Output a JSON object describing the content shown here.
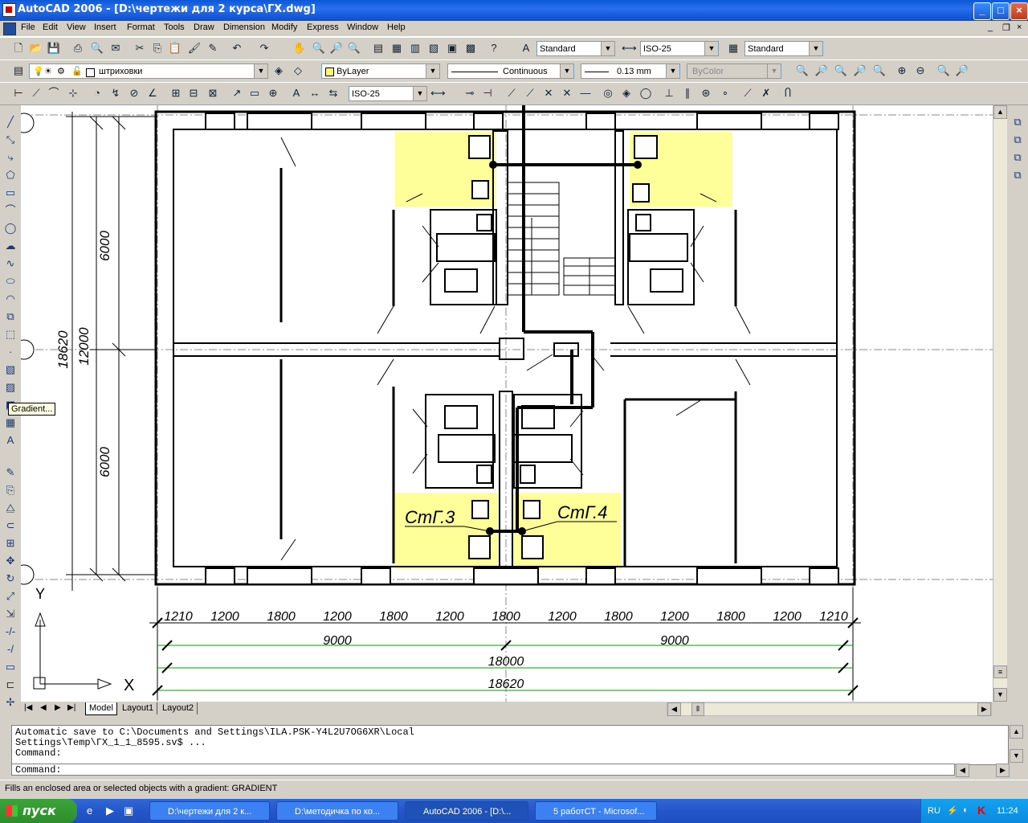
{
  "window": {
    "title": "AutoCAD 2006 - [D:\\чертежи для 2 курса\\ГХ.dwg]"
  },
  "menu": [
    "File",
    "Edit",
    "View",
    "Insert",
    "Format",
    "Tools",
    "Draw",
    "Dimension",
    "Modify",
    "Express",
    "Window",
    "Help"
  ],
  "toolbar_styles": {
    "text_style": "Standard",
    "dim_style": "ISO-25",
    "table_style": "Standard"
  },
  "toolbar_layers": {
    "layer": "штриховки",
    "color": "ByLayer",
    "linetype": "Continuous",
    "lineweight": "0.13 mm",
    "plotstyle": "ByColor"
  },
  "toolbar_dim": {
    "dim_style": "ISO-25"
  },
  "tooltip": "Gradient...",
  "drawing": {
    "dims_left": [
      "6000",
      "12000",
      "6000",
      "18620"
    ],
    "dims_bottom": [
      "1210",
      "1200",
      "1800",
      "1200",
      "1800",
      "1200",
      "1800",
      "1200",
      "1800",
      "1200",
      "1800",
      "1200",
      "1210"
    ],
    "dims_total1": [
      "9000",
      "9000"
    ],
    "dims_total2": "18000",
    "dims_total3": "18620",
    "labels": [
      "СтГ.3",
      "СтГ.4"
    ],
    "ucs_x": "X",
    "ucs_y": "Y"
  },
  "tabs": [
    "Model",
    "Layout1",
    "Layout2"
  ],
  "command": {
    "history": "Automatic save to C:\\Documents and Settings\\ILA.PSK-Y4L2U7OG6XR\\Local\nSettings\\Temp\\ГХ_1_1_8595.sv$ ...\nCommand:",
    "prompt": "Command:"
  },
  "status_text": "Fills an enclosed area or selected objects with a gradient:  GRADIENT",
  "taskbar": {
    "start": "пуск",
    "tasks": [
      "D:\\чертежи для 2 к...",
      "D:\\методичка по ко...",
      "AutoCAD 2006 - [D:\\...",
      "5 работСТ - Microsof..."
    ],
    "lang": "RU",
    "clock": "11:24"
  },
  "colors": {
    "titlebar": "#0a58d8",
    "highlight": "#ffff99",
    "dim_green": "#00a000",
    "taskbar": "#2456c9"
  }
}
